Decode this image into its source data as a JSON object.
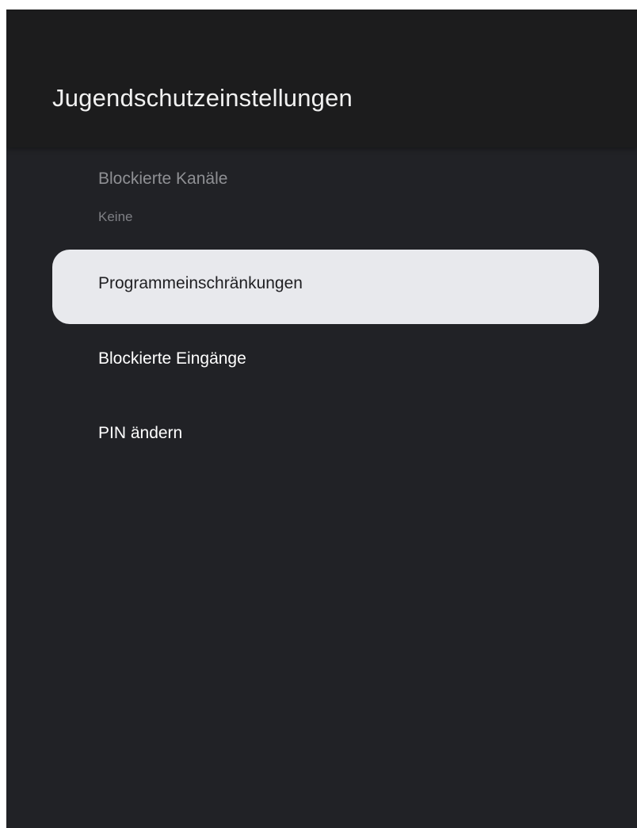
{
  "header": {
    "title": "Jugendschutzeinstellungen"
  },
  "menu": {
    "items": [
      {
        "label": "Blockierte Kanäle",
        "sublabel": "Keine",
        "state": "disabled"
      },
      {
        "label": "Programmeinschränkungen",
        "state": "focused"
      },
      {
        "label": "Blockierte Eingänge",
        "state": "normal"
      },
      {
        "label": "PIN ändern",
        "state": "normal"
      }
    ]
  },
  "colors": {
    "background": "#212226",
    "header_background": "#1c1c1d",
    "focus_highlight": "#e8e9ed",
    "text_primary": "#ffffff",
    "text_disabled": "#8f9094"
  }
}
